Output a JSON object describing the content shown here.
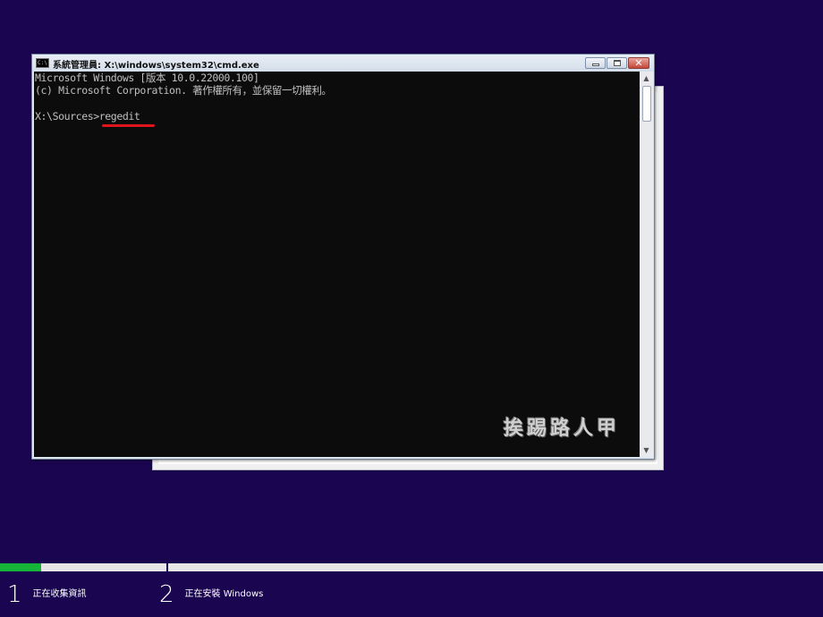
{
  "cmd_window": {
    "title": "系統管理員: X:\\windows\\system32\\cmd.exe",
    "icon_text": "C:\\",
    "close_label": "✕",
    "console_lines": [
      "Microsoft Windows [版本 10.0.22000.100]",
      "(c) Microsoft Corporation. 著作權所有，並保留一切權利。",
      "",
      "X:\\Sources>regedit"
    ],
    "watermark": "挨踢路人甲"
  },
  "setup": {
    "progress_fraction": 0.05,
    "steps": [
      {
        "number": "1",
        "label": "正在收集資訊"
      },
      {
        "number": "2",
        "label": "正在安裝 Windows"
      }
    ]
  },
  "colors": {
    "background": "#1a0550",
    "progress": "#17b43a",
    "highlight": "#e0141c"
  }
}
